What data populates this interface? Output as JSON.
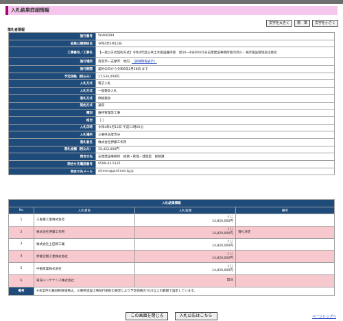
{
  "title": "入札結果詳細情報",
  "font_size_buttons": [
    "文字を大きく",
    "標　準",
    "文字を小さく"
  ],
  "section_label": "落札者情報",
  "info_rows": [
    {
      "label": "施行番号",
      "value": "50400299"
    },
    {
      "label": "結果公開開始日",
      "value": "令和4年4月12日"
    },
    {
      "label": "工事番号／工事名",
      "value": "【一括び方式契約方式】令和4年度公共土木施設維持管　第50ー4号00001号志摩建設事務所管内河川・海岸施設環境美化委託"
    },
    {
      "label": "施行場所",
      "value": "鳥羽市ー志摩市　地内",
      "link": "（詳細情報表示）"
    },
    {
      "label": "施行期間",
      "value": "契約の日から令和6年2月28日 まで"
    },
    {
      "label": "予定価格（税込み）",
      "value": "17,534,000円"
    },
    {
      "label": "入札方式",
      "value": "電子入札"
    },
    {
      "label": "入札方式",
      "value": "一般競争入札"
    },
    {
      "label": "落札方式",
      "value": "価格競争"
    },
    {
      "label": "契約方式",
      "value": "通常"
    },
    {
      "label": "種別",
      "value": "維持管理等工事"
    },
    {
      "label": "格付",
      "value": "［-］"
    },
    {
      "label": "入札日時",
      "value": "令和4年4月12日 午前11時02分"
    },
    {
      "label": "入札場所",
      "value": "三重県志摩市分"
    },
    {
      "label": "落札者名",
      "value": "株式会社伊藤工作所"
    },
    {
      "label": "落札金額（税込み）",
      "value": "15,422,000円"
    },
    {
      "label": "問合せ先",
      "value": "志摩建設事務所　総務・管理・建築室　総務課"
    },
    {
      "label": "問合せ先電話番号",
      "value": "0599-43-5125"
    },
    {
      "label": "問合せ先メール",
      "value": "shimen@pref.mie.lg.jp"
    }
  ],
  "results": {
    "caption": "入札結果情報",
    "headers": {
      "no": "No",
      "name": "入札者名",
      "amount": "入札金額",
      "note": "備考"
    },
    "rows": [
      {
        "no": "1",
        "name": "三重重工業株式会社",
        "amount_top": "くじ",
        "amount": "14,820,000円",
        "note": ""
      },
      {
        "no": "2",
        "name": "株式会社伊藤工作所",
        "amount_top": "くじ",
        "amount": "14,820,000円",
        "note": "落札決定"
      },
      {
        "no": "3",
        "name": "株式会社上田新工業",
        "amount_top": "くじ",
        "amount": "14,820,000円",
        "note": ""
      },
      {
        "no": "4",
        "name": "伊藤営繕工業株式会社",
        "amount_top": "くじ",
        "amount": "14,820,000円",
        "note": ""
      },
      {
        "no": "5",
        "name": "中部産業株式会社",
        "amount_top": "くじ",
        "amount": "14,820,000円",
        "note": ""
      },
      {
        "no": "6",
        "name": "東海メンテナンス株式会社",
        "amount_top": "",
        "amount": "無効",
        "note": ""
      }
    ],
    "remarks_label": "備考",
    "remarks_text": "※本案件の最低制限価格は、三重県建設工事執行規則の規定により予定価格の7/10以上の範囲で設定しています。"
  },
  "bottom_buttons": {
    "close": "この画面を閉じる",
    "notice": "入札公告はこちら"
  },
  "page_top_link": "ページトップへ"
}
